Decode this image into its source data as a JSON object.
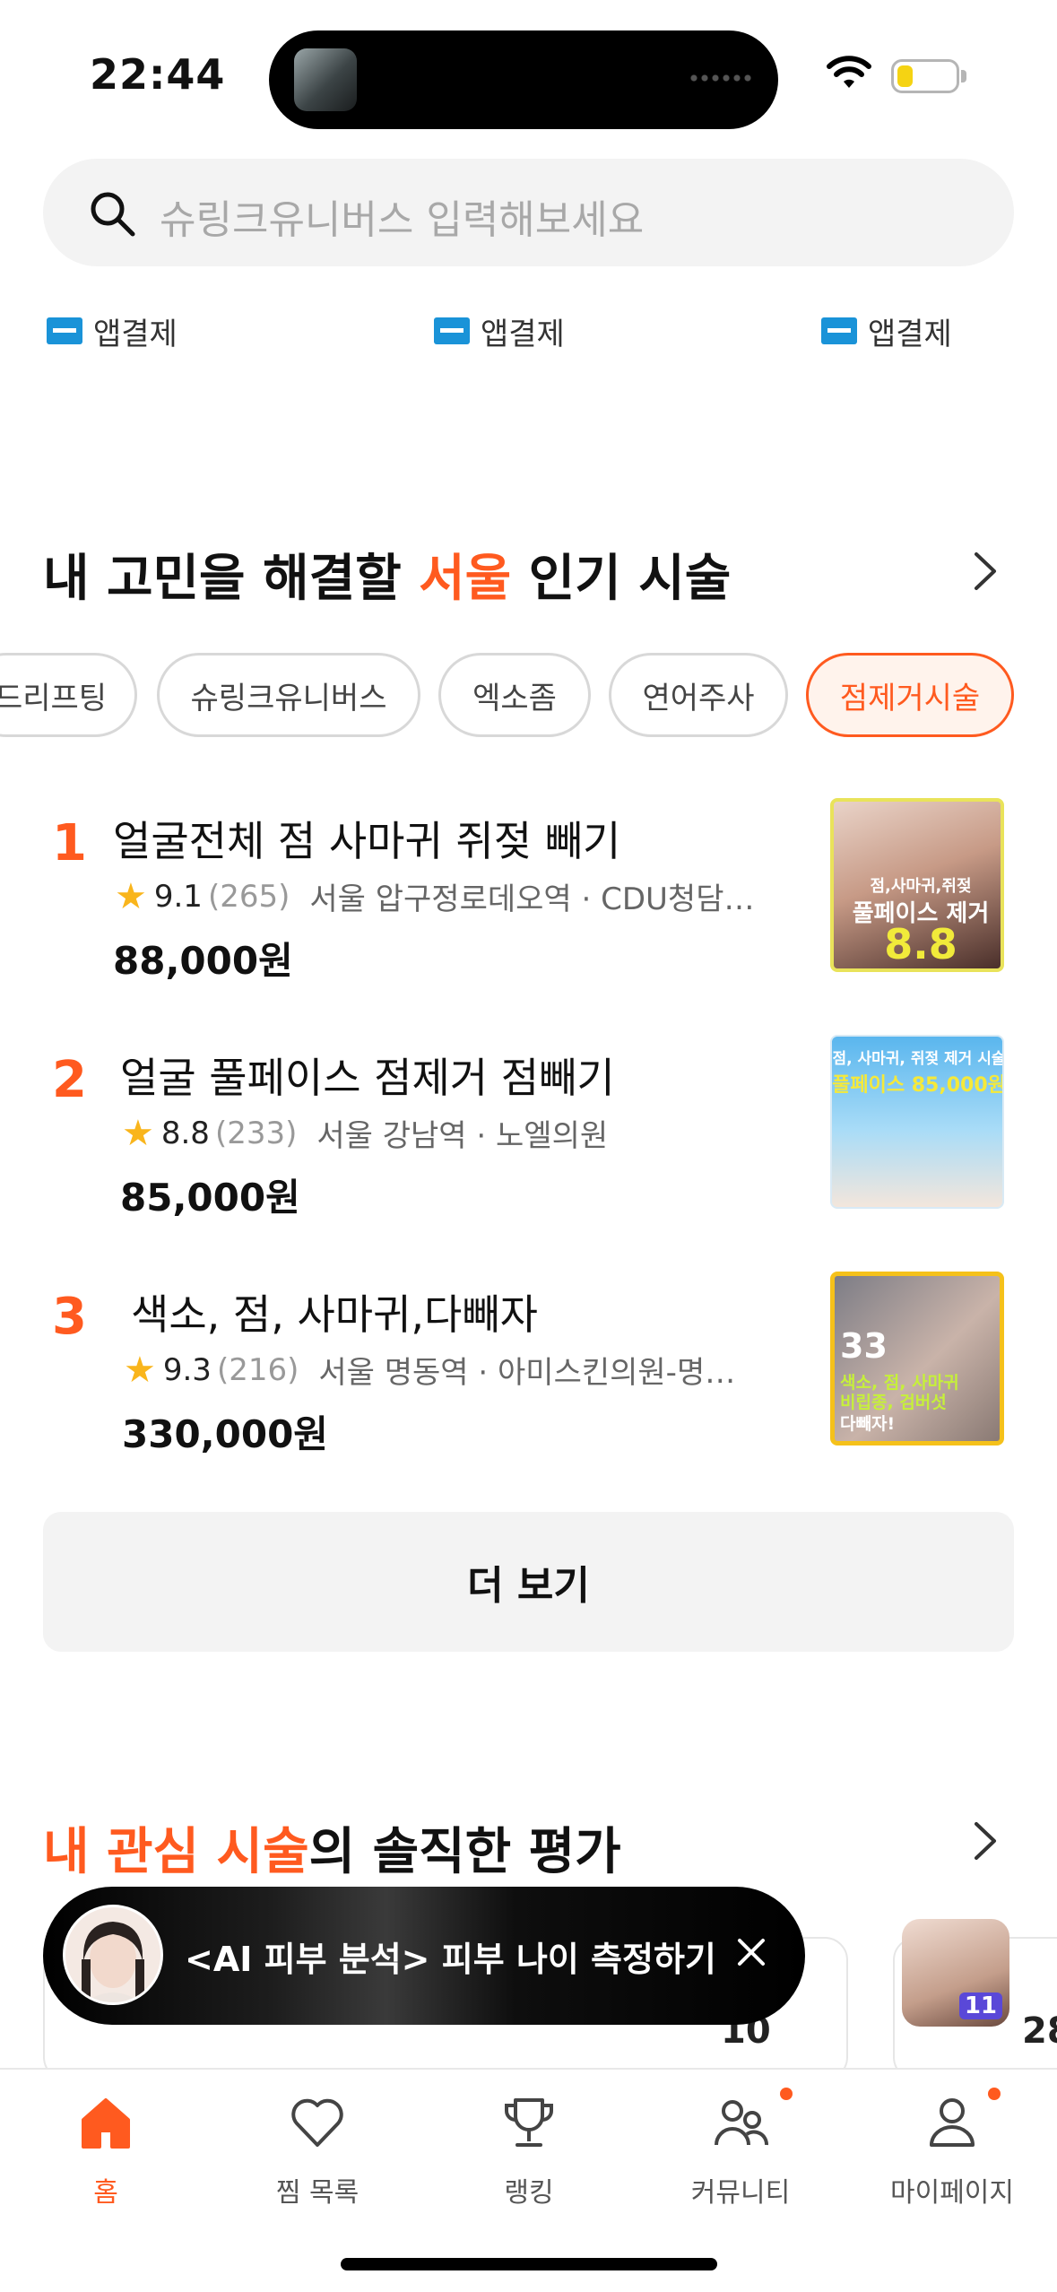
{
  "status_bar": {
    "time": "22:44"
  },
  "search": {
    "placeholder": "슈링크유니버스 입력해보세요"
  },
  "pay_chips": [
    "앱결제",
    "앱결제",
    "앱결제"
  ],
  "popular": {
    "title_prefix": "내 고민을 해결할 ",
    "title_highlight": "서울",
    "title_suffix": " 인기 시술",
    "chips": [
      "드리프팅",
      "슈링크유니버스",
      "엑소좀",
      "연어주사",
      "점제거시술"
    ],
    "active_chip": "점제거시술",
    "items": [
      {
        "rank": "1",
        "title": "얼굴전체 점 사마귀 쥐젖 빼기",
        "rating": "9.1",
        "count": "(265)",
        "location": "서울 압구정로데오역 · CDU청담…",
        "price": "88,000원",
        "thumb_lines": [
          "점,사마귀,쥐젖",
          "풀페이스 제거",
          "8.8"
        ]
      },
      {
        "rank": "2",
        "title": "얼굴 풀페이스 점제거 점빼기",
        "rating": "8.8",
        "count": "(233)",
        "location": "서울 강남역 · 노엘의원",
        "price": "85,000원",
        "thumb_lines": [
          "점, 사마귀, 쥐젖 제거 시술",
          "풀페이스 85,000원"
        ]
      },
      {
        "rank": "3",
        "title": "색소, 점, 사마귀,다빼자",
        "rating": "9.3",
        "count": "(216)",
        "location": "서울 명동역 · 아미스킨의원-명…",
        "price": "330,000원",
        "thumb_lines": [
          "33",
          "색소, 점, 사마귀",
          "비립종, 검버섯",
          "다빼자!"
        ]
      }
    ],
    "more_label": "더 보기"
  },
  "reviews": {
    "title_highlight": "내 관심 시술",
    "title_suffix": "의 솔직한 평가",
    "card_scores": [
      "10",
      "28"
    ],
    "card_badge": "11"
  },
  "ai_banner": {
    "text": "<AI 피부 분석> 피부 나이 측정하기"
  },
  "nav": [
    {
      "label": "홈",
      "icon": "home-icon"
    },
    {
      "label": "찜 목록",
      "icon": "heart-icon"
    },
    {
      "label": "랭킹",
      "icon": "trophy-icon"
    },
    {
      "label": "커뮤니티",
      "icon": "community-icon"
    },
    {
      "label": "마이페이지",
      "icon": "profile-icon"
    }
  ],
  "colors": {
    "accent": "#ff5a1f",
    "pay_blue": "#1a93d8",
    "star": "#f9b51c"
  }
}
